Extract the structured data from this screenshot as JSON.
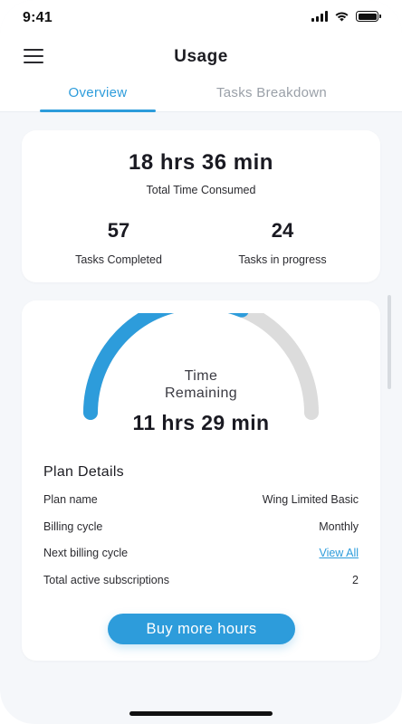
{
  "status_bar": {
    "time": "9:41"
  },
  "header": {
    "title": "Usage"
  },
  "tabs": [
    {
      "label": "Overview",
      "active": true
    },
    {
      "label": "Tasks Breakdown",
      "active": false
    }
  ],
  "summary": {
    "total_time": "18 hrs 36 min",
    "total_label": "Total Time Consumed",
    "tasks_completed": {
      "value": "57",
      "label": "Tasks Completed"
    },
    "tasks_in_progress": {
      "value": "24",
      "label": "Tasks in progress"
    }
  },
  "gauge": {
    "label_line1": "Time",
    "label_line2": "Remaining",
    "value": "11 hrs 29 min",
    "fraction_filled": 0.62,
    "fill_color": "#2d9cdb",
    "track_color": "#dcdcdc"
  },
  "plan_details": {
    "heading": "Plan Details",
    "rows": [
      {
        "key": "Plan name",
        "value": "Wing Limited Basic"
      },
      {
        "key": "Billing cycle",
        "value": "Monthly"
      },
      {
        "key": "Next billing cycle",
        "value": "View All"
      },
      {
        "key": "Total active subscriptions",
        "value": "2"
      }
    ]
  },
  "actions": {
    "buy_label": "Buy more hours"
  },
  "icons": [
    "menu-icon",
    "signal-icon",
    "wifi-icon",
    "battery-icon"
  ],
  "colors": {
    "accent": "#2d9cdb",
    "background": "#f5f7fa"
  }
}
